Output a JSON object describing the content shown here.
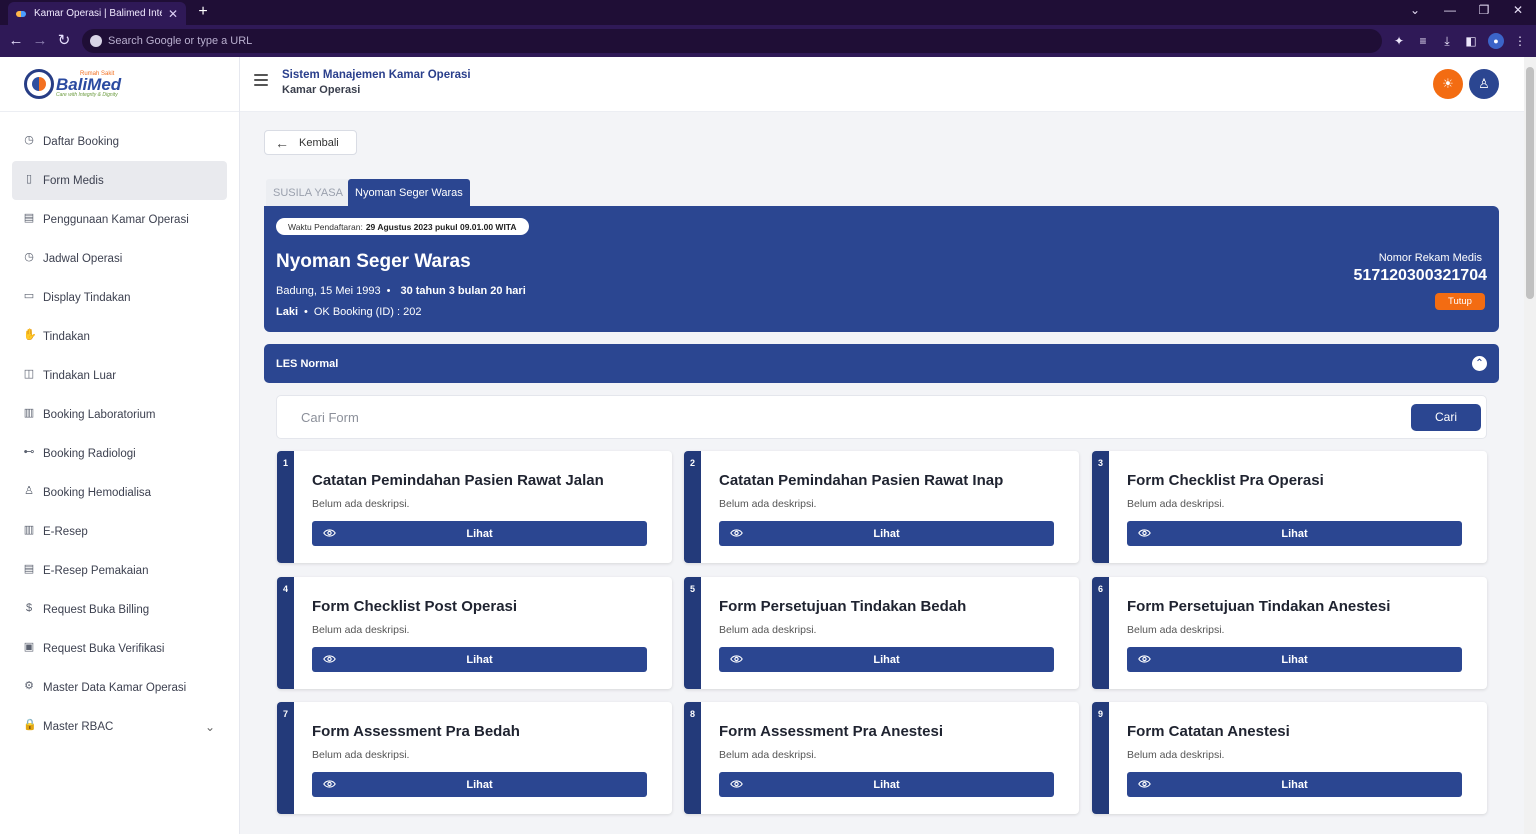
{
  "browser": {
    "tab_title": "Kamar Operasi | Balimed Integrat",
    "address_placeholder": "Search Google or type a URL"
  },
  "logo": {
    "small_text": "Rumah Sakit",
    "name": "BaliMed",
    "tagline": "Care with Integrity & Dignity"
  },
  "sidebar": {
    "items": [
      {
        "label": "Daftar Booking",
        "icon": "clock-icon",
        "glyph": "◷"
      },
      {
        "label": "Form Medis",
        "icon": "document-icon",
        "glyph": "▯",
        "active": true
      },
      {
        "label": "Penggunaan Kamar Operasi",
        "icon": "calendar-icon",
        "glyph": "▤"
      },
      {
        "label": "Jadwal Operasi",
        "icon": "clock-icon",
        "glyph": "◷"
      },
      {
        "label": "Display Tindakan",
        "icon": "monitor-icon",
        "glyph": "▭"
      },
      {
        "label": "Tindakan",
        "icon": "hand-icon",
        "glyph": "✋"
      },
      {
        "label": "Tindakan Luar",
        "icon": "box-icon",
        "glyph": "◫"
      },
      {
        "label": "Booking Laboratorium",
        "icon": "book-icon",
        "glyph": "▥"
      },
      {
        "label": "Booking Radiologi",
        "icon": "radiology-icon",
        "glyph": "⊷"
      },
      {
        "label": "Booking Hemodialisa",
        "icon": "user-icon",
        "glyph": "♙"
      },
      {
        "label": "E-Resep",
        "icon": "open-book-icon",
        "glyph": "▥"
      },
      {
        "label": "E-Resep Pemakaian",
        "icon": "book-icon",
        "glyph": "▤"
      },
      {
        "label": "Request Buka Billing",
        "icon": "dollar-icon",
        "glyph": "$"
      },
      {
        "label": "Request Buka Verifikasi",
        "icon": "verify-icon",
        "glyph": "▣"
      },
      {
        "label": "Master Data Kamar Operasi",
        "icon": "gear-icon",
        "glyph": "⚙"
      },
      {
        "label": "Master RBAC",
        "icon": "lock-icon",
        "glyph": "🔒"
      }
    ]
  },
  "topbar": {
    "title": "Sistem Manajemen Kamar Operasi",
    "subtitle": "Kamar Operasi"
  },
  "main": {
    "back_label": "Kembali",
    "tabs": [
      {
        "label": "SUSILA YASA"
      },
      {
        "label": "Nyoman Seger Waras"
      }
    ],
    "patient": {
      "reg_label": "Waktu Pendaftaran:",
      "reg_value": "29 Agustus 2023 pukul 09.01.00 WITA",
      "name": "Nyoman Seger Waras",
      "birth": "Badung, 15 Mei 1993",
      "age": "30 tahun 3 bulan 20 hari",
      "gender": "Laki",
      "booking": "OK Booking (ID) : 202",
      "rm_label": "Nomor Rekam Medis",
      "rm_number": "517120300321704",
      "close_label": "Tutup"
    },
    "section_title": "LES Normal",
    "search": {
      "placeholder": "Cari Form",
      "button": "Cari"
    },
    "forms": [
      {
        "num": "1",
        "title": "Catatan Pemindahan Pasien Rawat Jalan",
        "desc": "Belum ada deskripsi.",
        "action": "Lihat"
      },
      {
        "num": "2",
        "title": "Catatan Pemindahan Pasien Rawat Inap",
        "desc": "Belum ada deskripsi.",
        "action": "Lihat"
      },
      {
        "num": "3",
        "title": "Form Checklist Pra Operasi",
        "desc": "Belum ada deskripsi.",
        "action": "Lihat"
      },
      {
        "num": "4",
        "title": "Form Checklist Post Operasi",
        "desc": "Belum ada deskripsi.",
        "action": "Lihat"
      },
      {
        "num": "5",
        "title": "Form Persetujuan Tindakan Bedah",
        "desc": "Belum ada deskripsi.",
        "action": "Lihat"
      },
      {
        "num": "6",
        "title": "Form Persetujuan Tindakan Anestesi",
        "desc": "Belum ada deskripsi.",
        "action": "Lihat"
      },
      {
        "num": "7",
        "title": "Form Assessment Pra Bedah",
        "desc": "Belum ada deskripsi.",
        "action": "Lihat"
      },
      {
        "num": "8",
        "title": "Form Assessment Pra Anestesi",
        "desc": "Belum ada deskripsi.",
        "action": "Lihat"
      },
      {
        "num": "9",
        "title": "Form Catatan Anestesi",
        "desc": "Belum ada deskripsi.",
        "action": "Lihat"
      }
    ]
  },
  "colors": {
    "primary": "#2b4691",
    "accent": "#f36c12",
    "stripe": "#233a7a"
  }
}
